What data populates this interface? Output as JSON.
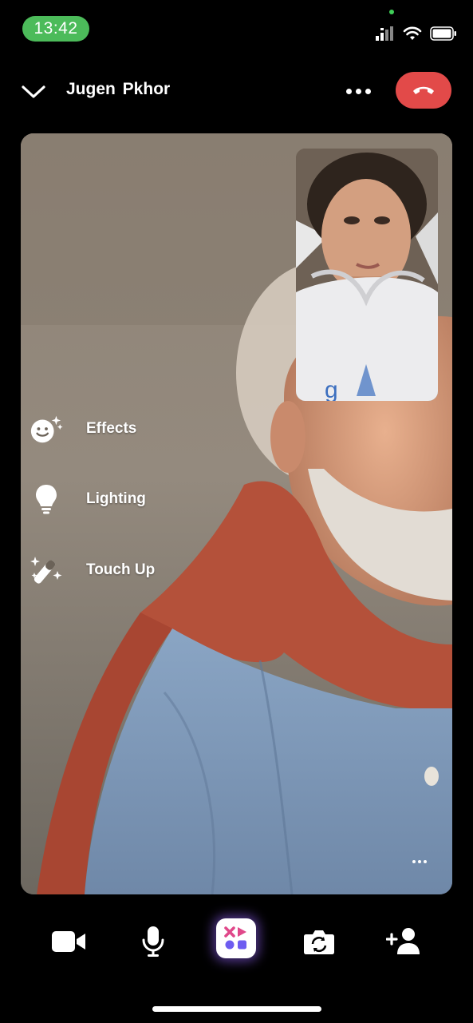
{
  "status_bar": {
    "time": "13:42",
    "icons": [
      "signal-icon",
      "wifi-icon",
      "battery-icon"
    ]
  },
  "header": {
    "contact_name": "Jugen  Pkhor",
    "end_call_color": "#e24a49"
  },
  "effects_menu": {
    "items": [
      {
        "label": "Effects",
        "icon": "smiley-sparkle-icon"
      },
      {
        "label": "Lighting",
        "icon": "lightbulb-icon"
      },
      {
        "label": "Touch Up",
        "icon": "magic-wand-icon"
      }
    ]
  },
  "toolbar": {
    "buttons": [
      "video-camera-icon",
      "microphone-icon",
      "effects-app-icon",
      "flip-camera-icon",
      "add-person-icon"
    ],
    "accent_glow": "#9a66ff"
  },
  "colors": {
    "status_time_bg": "#4cbb5a",
    "background": "#000000"
  }
}
